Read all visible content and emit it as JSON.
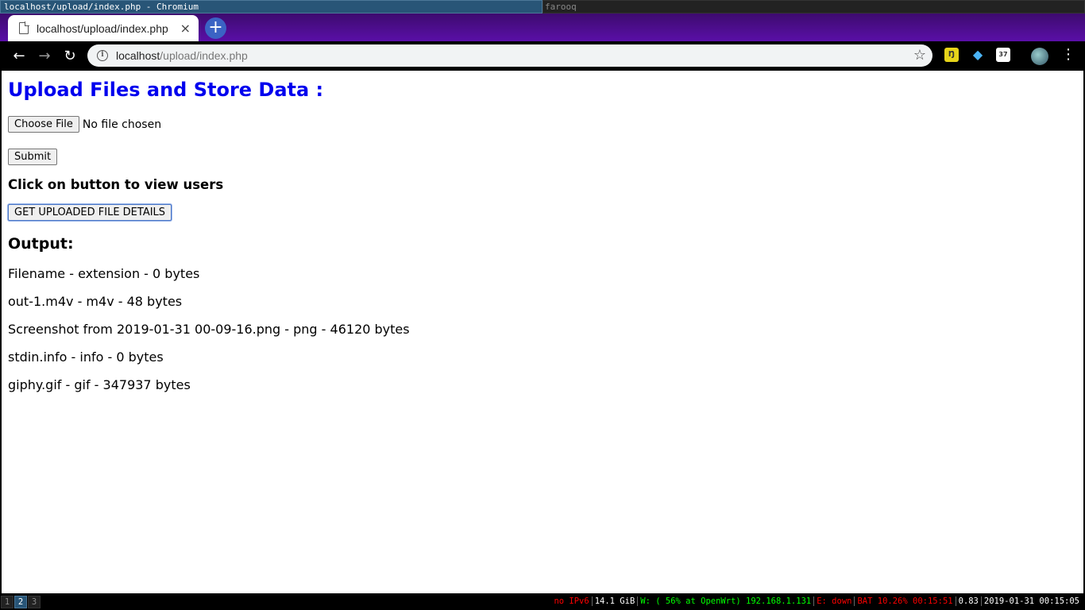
{
  "window": {
    "active_title": "localhost/upload/index.php - Chromium",
    "other_title": "farooq"
  },
  "browser": {
    "tab_title": "localhost/upload/index.php",
    "tab_close": "×",
    "new_tab": "+",
    "url_host": "localhost",
    "url_path": "/upload/index.php",
    "ext_1": "Ŋ",
    "ext_2": "◆",
    "ext_3": "37"
  },
  "page": {
    "heading": "Upload Files and Store Data :",
    "choose_file_label": "Choose File",
    "file_status": "No file chosen",
    "submit_label": "Submit",
    "view_users_heading": "Click on button to view users",
    "details_button_label": "GET UPLOADED FILE DETAILS",
    "output_heading": "Output:",
    "output_lines": [
      "Filename - extension - 0 bytes",
      "out-1.m4v - m4v - 48 bytes",
      "Screenshot from 2019-01-31 00-09-16.png - png - 46120 bytes",
      "stdin.info - info - 0 bytes",
      "giphy.gif - gif - 347937 bytes"
    ]
  },
  "statusbar": {
    "workspaces": [
      "1",
      "2",
      "3"
    ],
    "active_workspace": "2",
    "ipv6": "no IPv6",
    "disk": "14.1 GiB",
    "wifi": "W: ( 56% at OpenWrt) 192.168.1.131",
    "ethernet": "E: down",
    "battery": "BAT 10.26% 00:15:51",
    "load": "0.83",
    "datetime": "2019-01-31 00:15:05",
    "colors": {
      "ipv6": "#ff0000",
      "disk": "#ffffff",
      "wifi": "#00ff00",
      "ethernet": "#ff0000",
      "battery": "#ff0000",
      "load": "#ffffff",
      "datetime": "#ffffff"
    }
  }
}
